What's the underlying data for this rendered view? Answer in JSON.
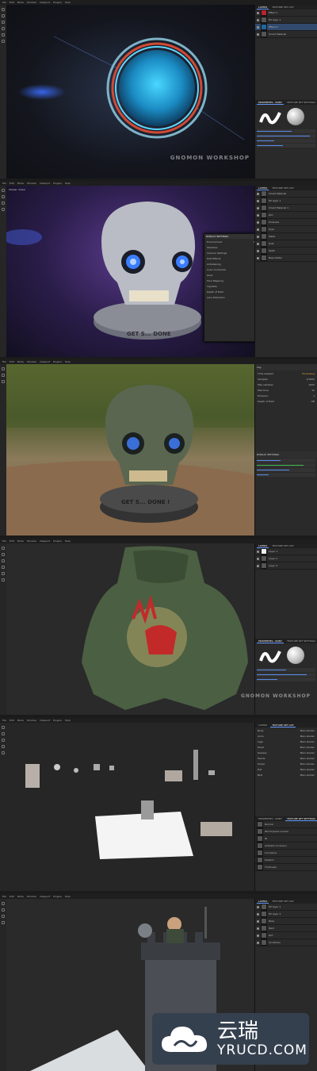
{
  "menu": [
    "File",
    "Edit",
    "Mode",
    "Window",
    "Viewport",
    "Plugins",
    "Help"
  ],
  "tabs": {
    "layers": "LAYERS",
    "texture_set_list": "TEXTURE SET LIST",
    "properties": "PROPERTIES - PAINT",
    "texture_set_settings": "TEXTURE SET SETTINGS"
  },
  "panel1": {
    "layers": [
      "Effect 1",
      "Fill layer 1",
      "Effect 2",
      "Smart Material"
    ],
    "watermark": "GNOMON WORKSHOP"
  },
  "panel2": {
    "viewport_label": "Shader: Sobel",
    "dialog_title": "DISPLAY SETTINGS",
    "dialog_rows": [
      "Environment",
      "Shadows",
      "Camera Settings",
      "Post Effects",
      "Antialiasing",
      "Color Correction",
      "Glow",
      "Tone Mapping",
      "Vignette",
      "Depth of Field",
      "Lens Distortion"
    ],
    "dialog_values": [
      "Panorama",
      "On",
      "50",
      "On",
      "On",
      "On",
      "On",
      "On",
      "On",
      "Off",
      "On"
    ],
    "viewport_text": "GET S... DONE",
    "layers": [
      "Smart Material",
      "Fill layer 1",
      "Smart Material 1",
      "Dirt",
      "Emissive",
      "Eyes",
      "Metal",
      "Rust",
      "Teeth",
      "Base Metal"
    ]
  },
  "panel3": {
    "side_title": "Iray",
    "side_rows": [
      "Time elapsed",
      "Samples",
      "Max samples",
      "Max time",
      "Emission",
      "Depth of Field"
    ],
    "side_values": [
      "Processing",
      "1/1000",
      "1000",
      "1h",
      "1",
      "Off"
    ],
    "display_title": "DISPLAY SETTINGS",
    "viewport_text": "GET S... DONE !"
  },
  "panel4": {
    "layers": [
      "Layer 1",
      "Layer 2",
      "Layer 3"
    ],
    "watermark": "GNOMON WORKSHOP"
  },
  "panel5": {
    "list": [
      "Body",
      "Arms",
      "Legs",
      "Head",
      "Glasses",
      "Hands",
      "Shoes",
      "Hat",
      "Belt"
    ],
    "list_values": [
      "Main shader",
      "Main shader",
      "Main shader",
      "Main shader",
      "Main shader",
      "Main shader",
      "Main shader",
      "Main shader",
      "Main shader"
    ],
    "maps": [
      "Normal",
      "World space normal",
      "ID",
      "Ambient occlusion",
      "Curvature",
      "Position",
      "Thickness"
    ]
  },
  "panel6": {
    "layers": [
      "Fill layer 1",
      "Fill layer 2",
      "Base",
      "Paint",
      "Dirt",
      "Scratches"
    ]
  },
  "logo": {
    "cn": "云瑞",
    "en": "YRUCD.COM"
  },
  "colors": {
    "accent": "#5a8be8",
    "bg": "#1b1b1b"
  }
}
